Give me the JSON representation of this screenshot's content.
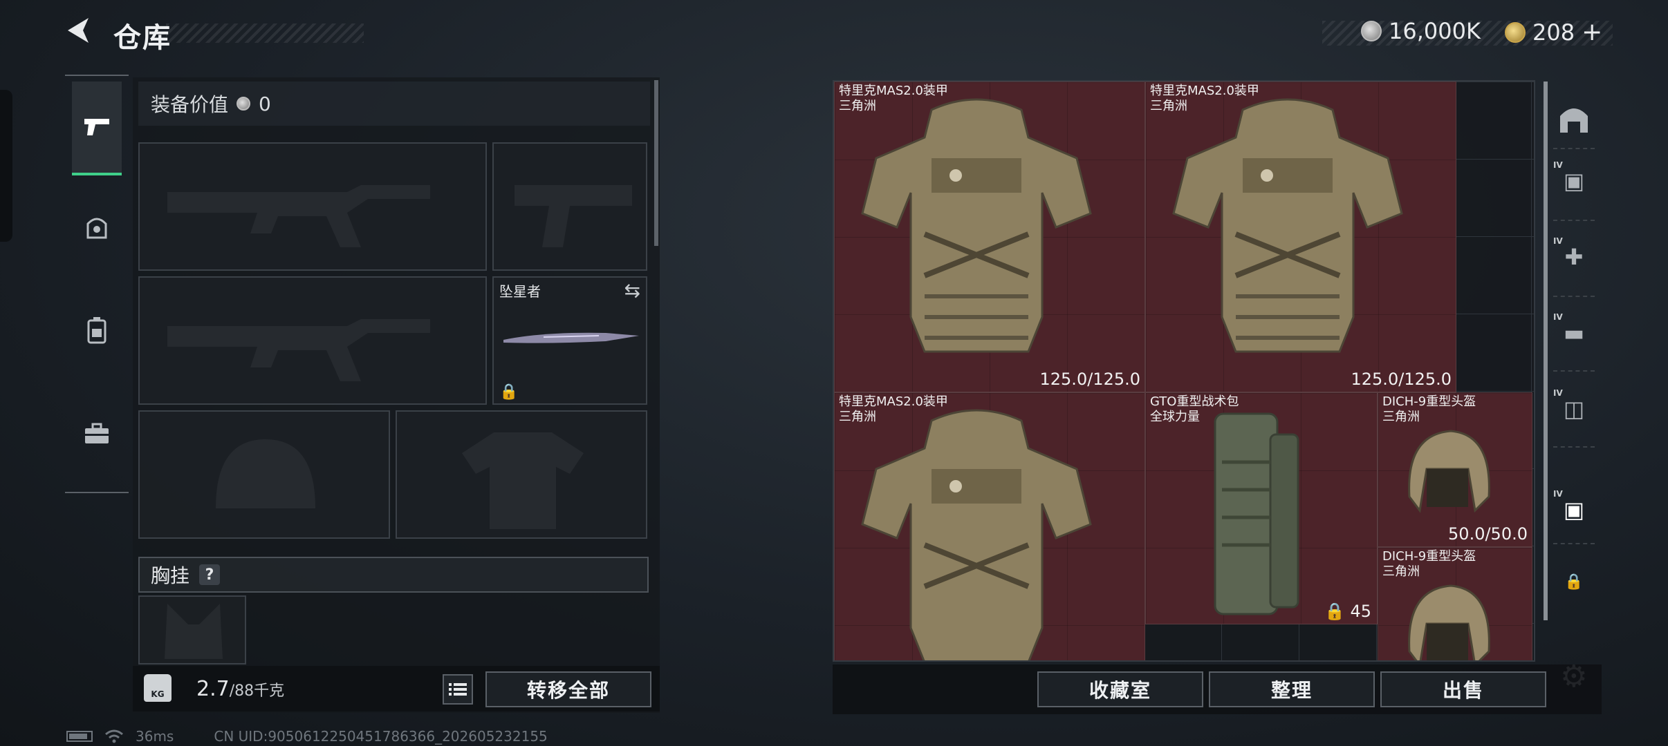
{
  "header": {
    "back_icon": "chevron-left-icon",
    "title": "仓库",
    "currency_silver": "16,000K",
    "currency_gold": "208",
    "plus": "+"
  },
  "left_rail": {
    "tabs": [
      {
        "icon": "pistol-icon",
        "active": true
      },
      {
        "icon": "helmet-person-icon",
        "active": false
      },
      {
        "icon": "backpack-icon",
        "active": false
      },
      {
        "icon": "toolbox-icon",
        "active": false
      }
    ]
  },
  "loadout": {
    "value_label": "装备价值",
    "value": "0",
    "knife_name": "坠星者",
    "rig_label": "胸挂",
    "rig_help": "?"
  },
  "weight": {
    "icon_text": "KG",
    "current": "2.7",
    "max": "/88千克"
  },
  "buttons": {
    "transfer_all": "转移全部",
    "collection": "收藏室",
    "sort": "整理",
    "sell": "出售"
  },
  "status_bar": {
    "ping": "36ms",
    "uid": "CN UID:9050612250451786366_202605232155"
  },
  "stash_items": [
    {
      "name": "特里克MAS2.0装甲",
      "sub": "三角洲",
      "durability": "125.0/125.0",
      "type": "armor"
    },
    {
      "name": "特里克MAS2.0装甲",
      "sub": "三角洲",
      "durability": "125.0/125.0",
      "type": "armor"
    },
    {
      "name": "特里克MAS2.0装甲",
      "sub": "三角洲",
      "durability": "",
      "type": "armor"
    },
    {
      "name": "GTO重型战术包",
      "sub": "全球力量",
      "count": "45",
      "type": "backpack"
    },
    {
      "name": "DICH-9重型头盔",
      "sub": "三角洲",
      "durability": "50.0/50.0",
      "type": "helmet"
    },
    {
      "name": "DICH-9重型头盔",
      "sub": "三角洲",
      "durability": "",
      "type": "helmet"
    }
  ],
  "right_rail": {
    "icons": [
      "home-storage-icon",
      "armor-crate-icon",
      "medkit-crate-icon",
      "weapon-crate-icon",
      "ammo-crate-icon",
      "armor-crate-icon",
      "lock-icon",
      "gear-icon"
    ],
    "level_label": "IV"
  },
  "colors": {
    "accent_green": "#3fd08a",
    "item_red": "#4c2329",
    "panel_dark": "#14181c"
  }
}
